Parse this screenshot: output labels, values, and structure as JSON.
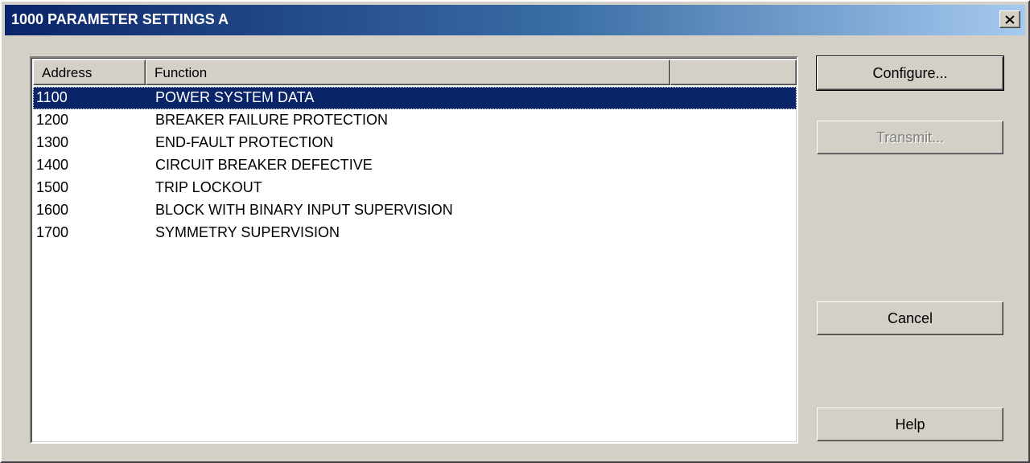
{
  "window": {
    "title": "1000 PARAMETER SETTINGS A",
    "close_icon": "close-icon"
  },
  "list": {
    "columns": [
      "Address",
      "Function",
      ""
    ],
    "rows": [
      {
        "address": "1100",
        "function": "POWER SYSTEM DATA",
        "selected": true
      },
      {
        "address": "1200",
        "function": "BREAKER FAILURE PROTECTION",
        "selected": false
      },
      {
        "address": "1300",
        "function": "END-FAULT PROTECTION",
        "selected": false
      },
      {
        "address": "1400",
        "function": "CIRCUIT BREAKER DEFECTIVE",
        "selected": false
      },
      {
        "address": "1500",
        "function": "TRIP LOCKOUT",
        "selected": false
      },
      {
        "address": "1600",
        "function": "BLOCK WITH BINARY INPUT SUPERVISION",
        "selected": false
      },
      {
        "address": "1700",
        "function": "SYMMETRY SUPERVISION",
        "selected": false
      }
    ]
  },
  "buttons": {
    "configure": "Configure...",
    "transmit": "Transmit...",
    "cancel": "Cancel",
    "help": "Help"
  },
  "colors": {
    "titlebar_start": "#0a246a",
    "titlebar_end": "#a6caf0",
    "selection": "#0a246a",
    "face": "#d4d0c8"
  }
}
